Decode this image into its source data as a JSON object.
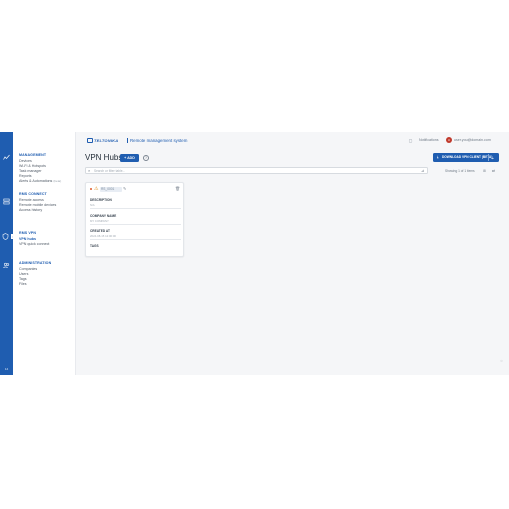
{
  "app": {
    "brand": "TELTONIKA",
    "title": "Remote management system",
    "version": "14"
  },
  "rail": {
    "icons": [
      "chart-icon",
      "server-icon",
      "shield-icon",
      "users-icon"
    ]
  },
  "nav": {
    "management": {
      "title": "MANAGEMENT",
      "items": [
        {
          "label": "Devices"
        },
        {
          "label": "Wi-Fi & Hotspots"
        },
        {
          "label": "Task manager"
        },
        {
          "label": "Reports"
        },
        {
          "label": "Alerts & Automations",
          "badge": "(beta)"
        }
      ]
    },
    "rms_connect": {
      "title": "RMS CONNECT",
      "items": [
        {
          "label": "Remote access"
        },
        {
          "label": "Remote mobile devices"
        },
        {
          "label": "Access history"
        }
      ]
    },
    "rms_vpn": {
      "title": "RMS VPN",
      "items": [
        {
          "label": "VPN hubs",
          "active": true
        },
        {
          "label": "VPN quick connect"
        }
      ]
    },
    "administration": {
      "title": "ADMINISTRATION",
      "items": [
        {
          "label": "Companies"
        },
        {
          "label": "Users"
        },
        {
          "label": "Tags"
        },
        {
          "label": "Files"
        }
      ]
    }
  },
  "topbar": {
    "notifications_label": "Notifications",
    "user_label": "user.you@domain.com",
    "avatar_initial": "U"
  },
  "page": {
    "title": "VPN Hubs",
    "add_label": "ADD",
    "download_label": "DOWNLOAD VPN CLIENT (BETA)",
    "search_placeholder": "Search or filter table...",
    "showing": "Showing 1 of 1 items"
  },
  "card": {
    "name": "RS_0001",
    "fields": [
      {
        "label": "DESCRIPTION",
        "value": "N/A"
      },
      {
        "label": "COMPANY NAME",
        "value": "MY COMPANY"
      },
      {
        "label": "CREATED AT",
        "value": "2024-08-15 12:00:00"
      },
      {
        "label": "TAGS",
        "value": ""
      }
    ]
  },
  "colors": {
    "primary": "#1f5db0",
    "warning": "#e0962a",
    "status": "#e05a2a",
    "page_bg": "#f5f6f8"
  }
}
